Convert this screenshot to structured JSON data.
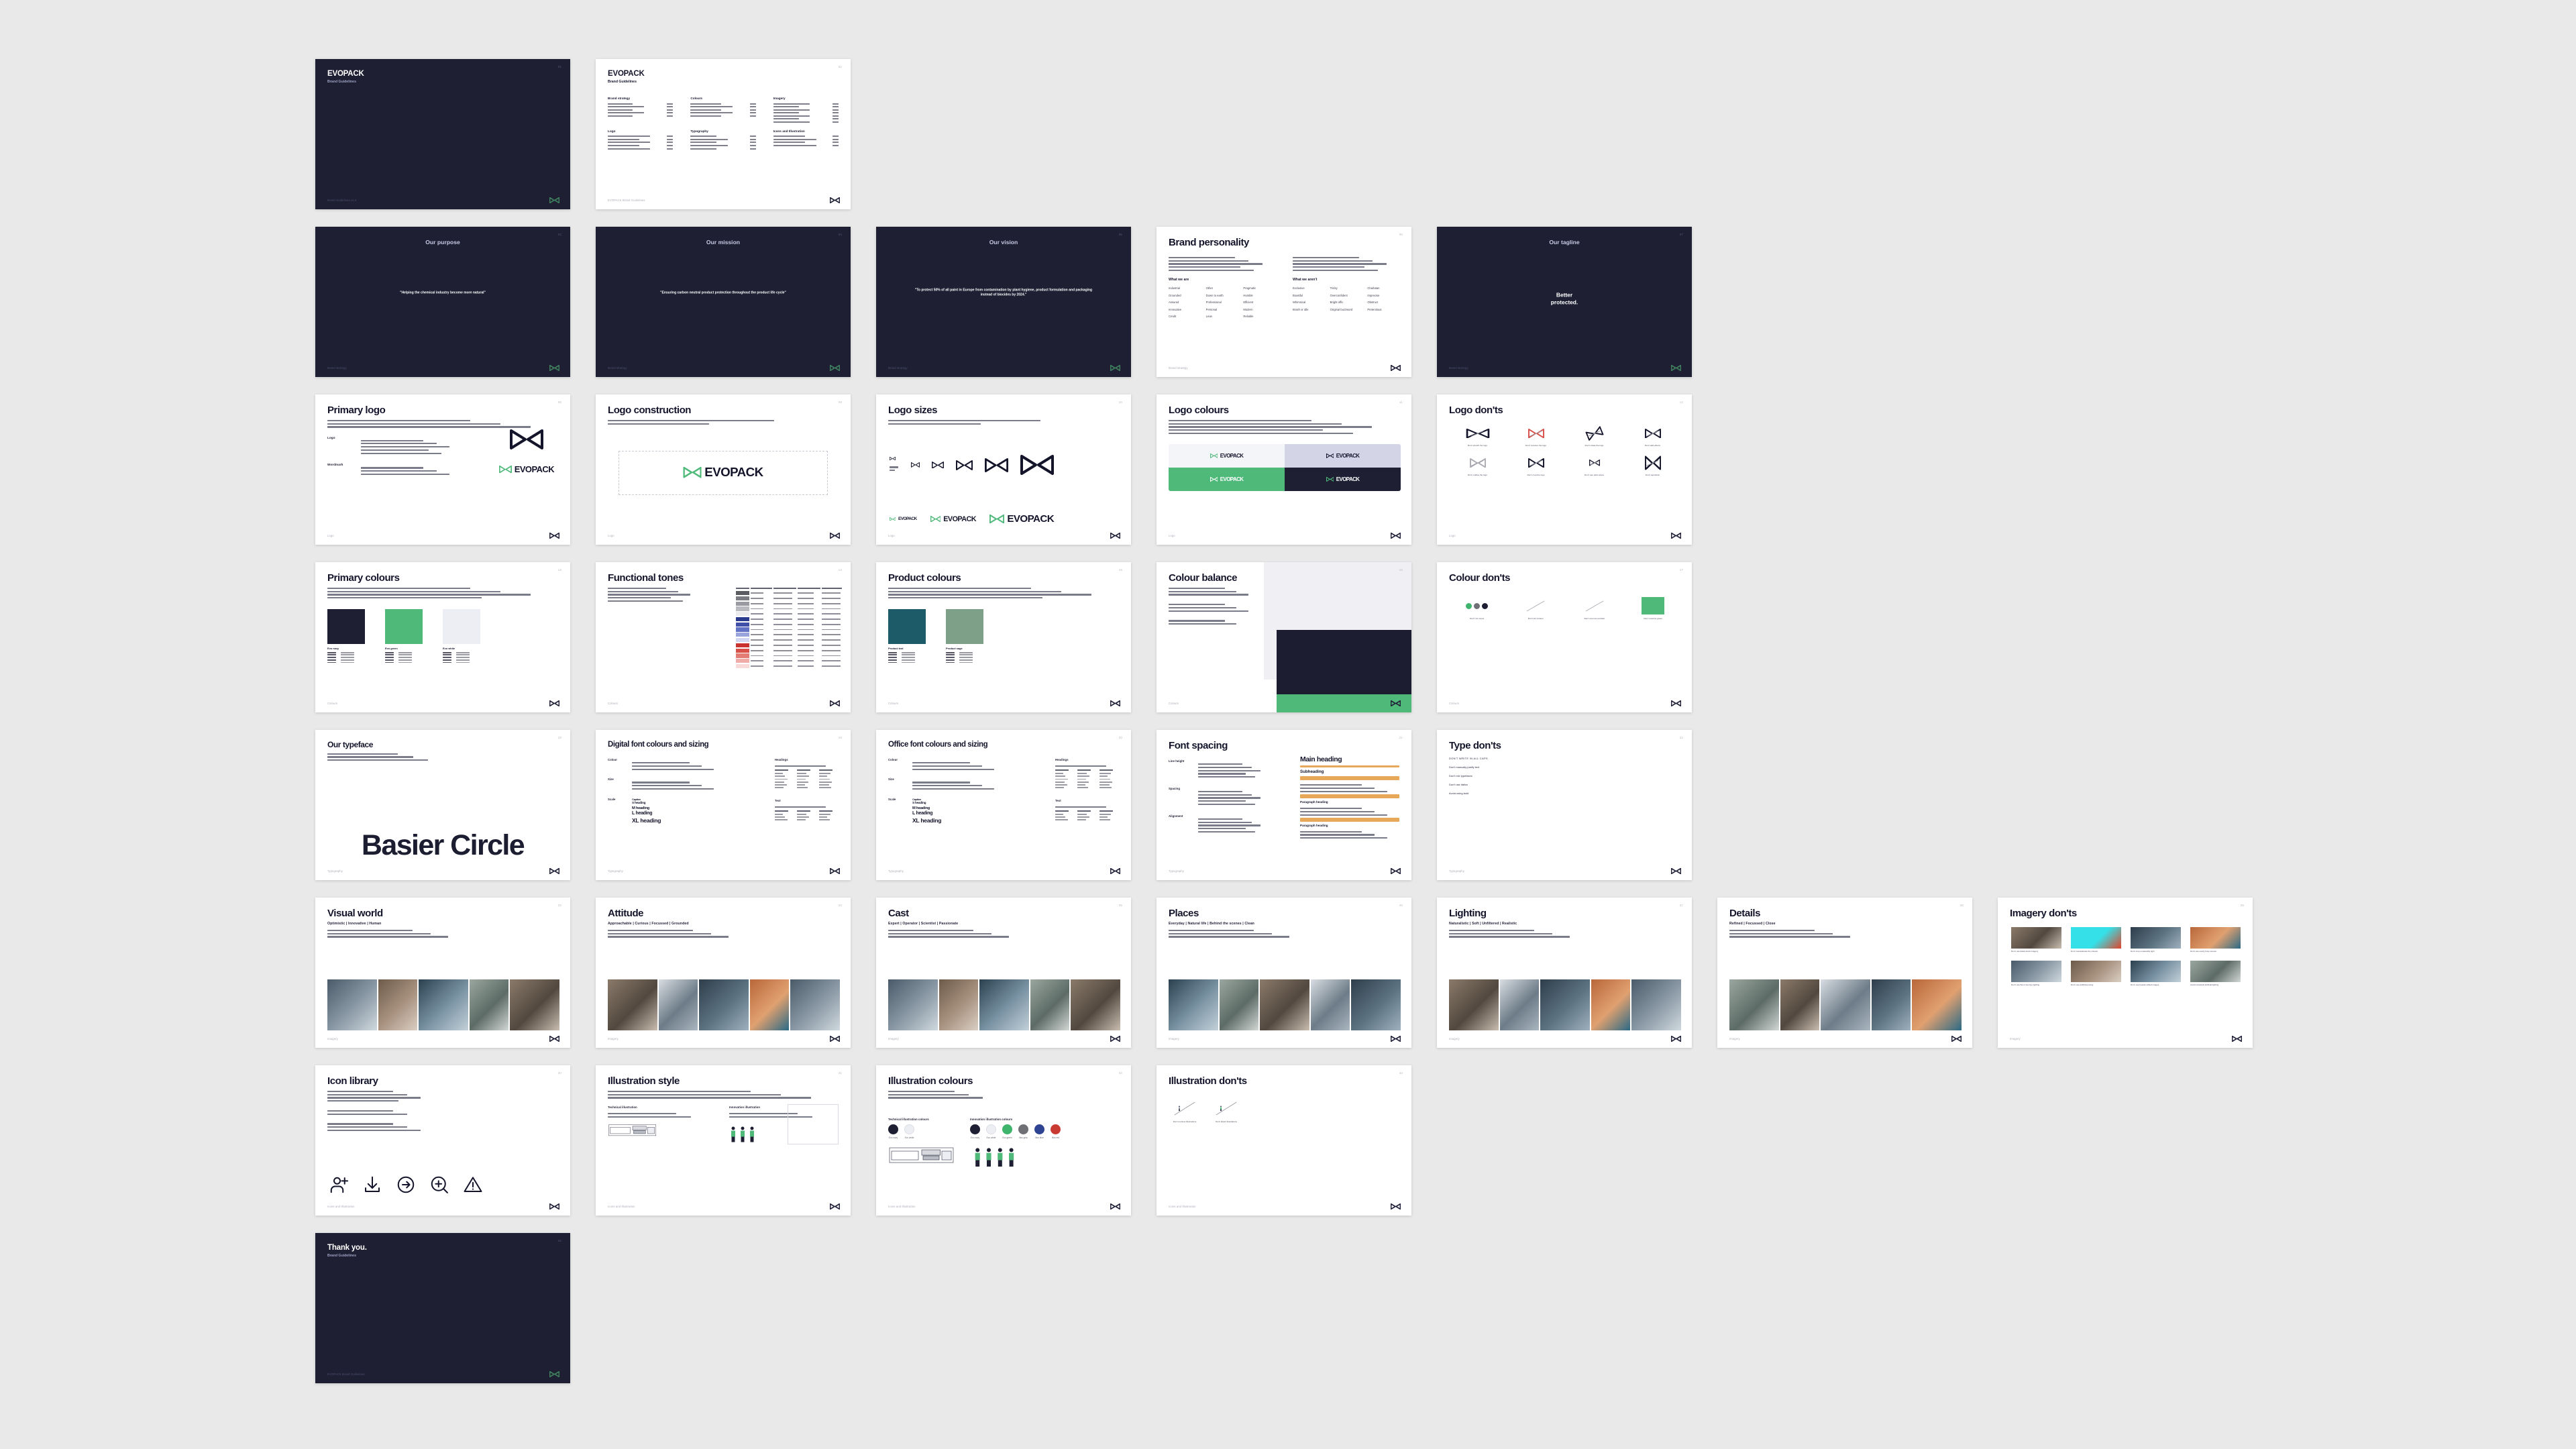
{
  "deck": {
    "brand": "EVOPACK",
    "document_title": "Brand Guidelines",
    "footer_text": "EVOPACK Brand Guidelines",
    "colors": {
      "navy": "#1e1f33",
      "green": "#4fb97a",
      "light": "#eceef3",
      "accent_orange": "#e8a85a",
      "lilac": "#d3d4e6"
    }
  },
  "slides": [
    {
      "id": "cover",
      "page": "01",
      "kind": "cover-dark",
      "title": "EVOPACK",
      "subtitle": "Brand Guidelines",
      "footer": "Brand Guidelines v1.0"
    },
    {
      "id": "contents",
      "page": "02",
      "kind": "contents",
      "title": "EVOPACK",
      "subtitle": "Brand Guidelines",
      "footer": "EVOPACK Brand Guidelines",
      "groups": [
        {
          "heading": "Brand strategy",
          "count": 5
        },
        {
          "heading": "Colours",
          "count": 5
        },
        {
          "heading": "Imagery",
          "count": 7
        },
        {
          "heading": "Logo",
          "count": 5
        },
        {
          "heading": "Typography",
          "count": 5
        },
        {
          "heading": "Icons and Illustration",
          "count": 4
        }
      ]
    },
    {
      "id": "purpose",
      "page": "03",
      "kind": "statement",
      "title": "Our purpose",
      "statement": "\"Helping the chemical industry become more natural\"",
      "footer": "Brand strategy"
    },
    {
      "id": "mission",
      "page": "04",
      "kind": "statement",
      "title": "Our mission",
      "statement": "\"Ensuring carbon neutral product protection throughout the product life cycle\"",
      "footer": "Brand strategy"
    },
    {
      "id": "vision",
      "page": "05",
      "kind": "statement",
      "title": "Our vision",
      "statement": "\"To protect 50% of all paint in Europe from contamination by plant hygiene, product formulation and packaging instead of biocides by 2024.\"",
      "footer": "Brand strategy"
    },
    {
      "id": "personality",
      "page": "06",
      "kind": "personality",
      "title": "Brand personality",
      "col_left_heading": "What we are",
      "col_right_heading": "What we aren't",
      "are": [
        "Industrial",
        "Other",
        "Pragmatic",
        "Grounded",
        "Down to earth",
        "Humble",
        "Assured",
        "Professional",
        "Efficient",
        "Innovative",
        "Personal",
        "Modern",
        "Credit",
        "Lean",
        "Reliable"
      ],
      "arent": [
        "Exclusive",
        "Tricky",
        "Charlatan",
        "Boastful",
        "Overconfident",
        "Imprecise",
        "Whimsical",
        "Bright offic",
        "Obstruct",
        "Brash or idle",
        "Original buzzword",
        "Pretentious"
      ],
      "footer": "Brand strategy"
    },
    {
      "id": "tagline",
      "page": "07",
      "kind": "statement-big",
      "title": "Our tagline",
      "statement": "Better\nprotected.",
      "footer": "Brand strategy"
    },
    {
      "id": "primary-logo",
      "page": "08",
      "kind": "primary-logo",
      "title": "Primary logo",
      "rows": [
        {
          "label": "Logo",
          "lines": 5
        },
        {
          "label": "Wordmark",
          "lines": 3
        }
      ],
      "footer": "Logo"
    },
    {
      "id": "logo-construction",
      "page": "09",
      "kind": "logo-construction",
      "title": "Logo construction",
      "footer": "Logo"
    },
    {
      "id": "logo-sizes",
      "page": "10",
      "kind": "logo-sizes",
      "title": "Logo sizes",
      "footer": "Logo"
    },
    {
      "id": "logo-colours",
      "page": "11",
      "kind": "logo-colours",
      "title": "Logo colours",
      "quadrants": [
        {
          "bg": "#f4f5f8",
          "word": "#14152b",
          "mark": "#4fb97a"
        },
        {
          "bg": "#d3d4e6",
          "word": "#14152b",
          "mark": "#14152b"
        },
        {
          "bg": "#4fb97a",
          "word": "#ffffff",
          "mark": "#ffffff"
        },
        {
          "bg": "#1e1f33",
          "word": "#ffffff",
          "mark": "#4fb97a"
        }
      ],
      "footer": "Logo"
    },
    {
      "id": "logo-donts",
      "page": "12",
      "kind": "donts-grid",
      "title": "Logo don'ts",
      "items": [
        "Don't stretch the logo",
        "Don't recolour the logo",
        "Don't rotate the logo",
        "Don't add effects",
        "Don't outline the logo",
        "Don't crop the logo",
        "Don't use parts alone",
        "Don't reposition"
      ],
      "footer": "Logo"
    },
    {
      "id": "primary-colours",
      "page": "13",
      "kind": "colour-swatches",
      "title": "Primary colours",
      "swatches": [
        {
          "name": "Evo navy",
          "hex": "#1e1f33"
        },
        {
          "name": "Evo green",
          "hex": "#4fb97a"
        },
        {
          "name": "Evo white",
          "hex": "#eceef3"
        }
      ],
      "footer": "Colours"
    },
    {
      "id": "functional-tones",
      "page": "14",
      "kind": "functional-tones",
      "title": "Functional tones",
      "columns": [
        "Swatch",
        "Name",
        "HEX",
        "RGB",
        "Usage"
      ],
      "ramps": [
        [
          "#5c5c63",
          "#7b7b83",
          "#9a9aa2",
          "#b9b9c0",
          "#ebebee"
        ],
        [
          "#2a3a8c",
          "#4050a8",
          "#6272c4",
          "#9aa4dc",
          "#d3d8f2"
        ],
        [
          "#c9322e",
          "#d9504a",
          "#e47c76",
          "#efaca8",
          "#f8dad8"
        ]
      ],
      "footer": "Colours"
    },
    {
      "id": "product-colours",
      "page": "15",
      "kind": "colour-swatches",
      "title": "Product colours",
      "swatches": [
        {
          "name": "Product teal",
          "hex": "#1d5b68"
        },
        {
          "name": "Product sage",
          "hex": "#7fa088"
        }
      ],
      "footer": "Colours"
    },
    {
      "id": "colour-balance",
      "page": "16",
      "kind": "colour-balance",
      "title": "Colour balance",
      "footer": "Colours"
    },
    {
      "id": "colour-donts",
      "page": "17",
      "kind": "colour-donts",
      "title": "Colour don'ts",
      "items": [
        "Don't mix tones",
        "Don't tint colours",
        "Don't use low contrast",
        "Don't overuse green"
      ],
      "footer": "Colours"
    },
    {
      "id": "typeface",
      "page": "18",
      "kind": "typeface",
      "title": "Our typeface",
      "typeface_name": "Basier Circle",
      "footer": "Typography"
    },
    {
      "id": "digital-font",
      "page": "19",
      "kind": "font-sizing",
      "title": "Digital font colours and sizing",
      "labels": [
        "Colour",
        "Size",
        "Scale"
      ],
      "scale": [
        "Caption",
        "S heading",
        "M heading",
        "L heading",
        "XL heading"
      ],
      "tables": [
        {
          "heading": "Headings",
          "cols": [
            "Size",
            "Px size",
            "Line height"
          ],
          "rows": 6
        },
        {
          "heading": "Text",
          "cols": [
            "Size",
            "Px size",
            "Line height"
          ],
          "rows": 3
        }
      ],
      "footer": "Typography"
    },
    {
      "id": "office-font",
      "page": "20",
      "kind": "font-sizing",
      "title": "Office font colours and sizing",
      "labels": [
        "Colour",
        "Size",
        "Scale"
      ],
      "scale": [
        "Caption",
        "S heading",
        "M heading",
        "L heading",
        "XL heading"
      ],
      "tables": [
        {
          "heading": "Headings",
          "cols": [
            "Size",
            "Pt size",
            "Line height"
          ],
          "rows": 6
        },
        {
          "heading": "Text",
          "cols": [
            "Size",
            "Pt size",
            "Line height"
          ],
          "rows": 3
        }
      ],
      "footer": "Typography"
    },
    {
      "id": "font-spacing",
      "page": "21",
      "kind": "font-spacing",
      "title": "Font spacing",
      "labels": [
        "Line height",
        "Spacing",
        "Alignment"
      ],
      "sample_main": "Main heading",
      "sample_sub": "Subheading",
      "sample_para": "Paragraph heading",
      "footer": "Typography"
    },
    {
      "id": "type-donts",
      "page": "22",
      "kind": "type-donts",
      "title": "Type don'ts",
      "items": [
        "DON'T WRITE IN ALL CAPS",
        "Don't manually justify text",
        "Don't mix typefaces",
        "Don't use italics",
        "Avoid using bold"
      ],
      "footer": "Typography"
    },
    {
      "id": "visual-world",
      "page": "23",
      "kind": "imagery",
      "title": "Visual world",
      "subtitle": "Optimistic | Innovative | Human",
      "footer": "Imagery"
    },
    {
      "id": "attitude",
      "page": "24",
      "kind": "imagery",
      "title": "Attitude",
      "subtitle": "Approachable | Curious | Focussed | Grounded",
      "footer": "Imagery"
    },
    {
      "id": "cast",
      "page": "25",
      "kind": "imagery",
      "title": "Cast",
      "subtitle": "Expert | Operator | Scientist | Passionate",
      "footer": "Imagery"
    },
    {
      "id": "places",
      "page": "26",
      "kind": "imagery",
      "title": "Places",
      "subtitle": "Everyday | Natural life | Behind the scenes | Clean",
      "footer": "Imagery"
    },
    {
      "id": "lighting",
      "page": "27",
      "kind": "imagery",
      "title": "Lighting",
      "subtitle": "Naturalistic | Soft | Unfiltered | Realistic",
      "footer": "Imagery"
    },
    {
      "id": "details",
      "page": "28",
      "kind": "imagery",
      "title": "Details",
      "subtitle": "Refined | Focussed | Close",
      "footer": "Imagery"
    },
    {
      "id": "imagery-donts",
      "page": "29",
      "kind": "imagery-donts",
      "title": "Imagery don'ts",
      "items": [
        "Don't use dated stock imagery",
        "Don't oversaturate the colours",
        "Don't crop unnaturally tight",
        "Don't use overly busy scenes",
        "Don't use flat or low key lighting",
        "Don't use artificial posing",
        "Don't use heavily edited images",
        "Avoid unnatural artificial lighting"
      ],
      "footer": "Imagery"
    },
    {
      "id": "icon-library",
      "page": "30",
      "kind": "icon-library",
      "title": "Icon library",
      "icons": [
        "add-user-icon",
        "download-icon",
        "arrow-right-circle-icon",
        "zoom-in-icon",
        "warning-icon"
      ],
      "footer": "Icons and Illustration"
    },
    {
      "id": "illustration-style",
      "page": "31",
      "kind": "illustration-style",
      "title": "Illustration style",
      "col_left_heading": "Technical illustration",
      "col_right_heading": "Innovation illustration",
      "footer": "Icons and Illustration"
    },
    {
      "id": "illustration-colours",
      "page": "32",
      "kind": "illustration-colours",
      "title": "Illustration colours",
      "col_left_heading": "Technical illustration colours",
      "col_right_heading": "Innovation illustration colours",
      "technical_colours": [
        {
          "name": "Evo navy",
          "hex": "#1e1f33"
        },
        {
          "name": "Evo white",
          "hex": "#eceef3"
        }
      ],
      "innovation_colours": [
        {
          "name": "Evo navy",
          "hex": "#1e1f33"
        },
        {
          "name": "Evo white",
          "hex": "#eceef3"
        },
        {
          "name": "Evo green",
          "hex": "#3eb46c"
        },
        {
          "name": "Illus grey",
          "hex": "#6f7075"
        },
        {
          "name": "Illus blue",
          "hex": "#2e4391"
        },
        {
          "name": "Illus red",
          "hex": "#c93a33"
        }
      ],
      "footer": "Icons and Illustration"
    },
    {
      "id": "illustration-donts",
      "page": "33",
      "kind": "illustration-donts",
      "title": "Illustration don'ts",
      "items": [
        "Don't recolour illustrations",
        "Don't distort illustrations"
      ],
      "footer": "Icons and Illustration"
    },
    {
      "id": "thank-you",
      "page": "34",
      "kind": "cover-dark",
      "title": "Thank you.",
      "subtitle": "Brand Guidelines",
      "footer": "EVOPACK Brand Guidelines"
    }
  ]
}
